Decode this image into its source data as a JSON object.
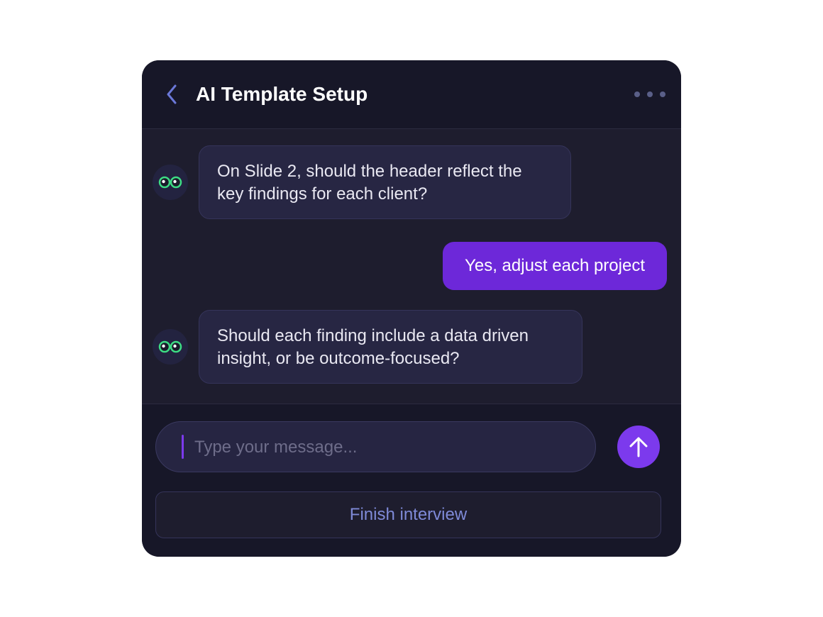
{
  "header": {
    "back_icon": "chevron-left-icon",
    "title": "AI Template Setup",
    "more_icon": "more-horizontal-icon"
  },
  "messages": [
    {
      "sender": "bot",
      "avatar_icon": "eyes-icon",
      "text": "On Slide 2, should the header reflect the key findings for each client?"
    },
    {
      "sender": "user",
      "text": "Yes, adjust each project"
    },
    {
      "sender": "bot",
      "avatar_icon": "eyes-icon",
      "text": "Should each finding include a data driven insight, or be outcome-focused?"
    }
  ],
  "composer": {
    "value": "",
    "placeholder": "Type your message...",
    "send_icon": "arrow-up-icon"
  },
  "finish_button": {
    "label": "Finish interview"
  },
  "colors": {
    "accent": "#7c3aed",
    "user_bubble": "#6d28d9",
    "panel_bg": "#1e1d2e",
    "header_bg": "#171728",
    "bot_bubble": "#272643",
    "eye_green": "#3ddc84"
  }
}
